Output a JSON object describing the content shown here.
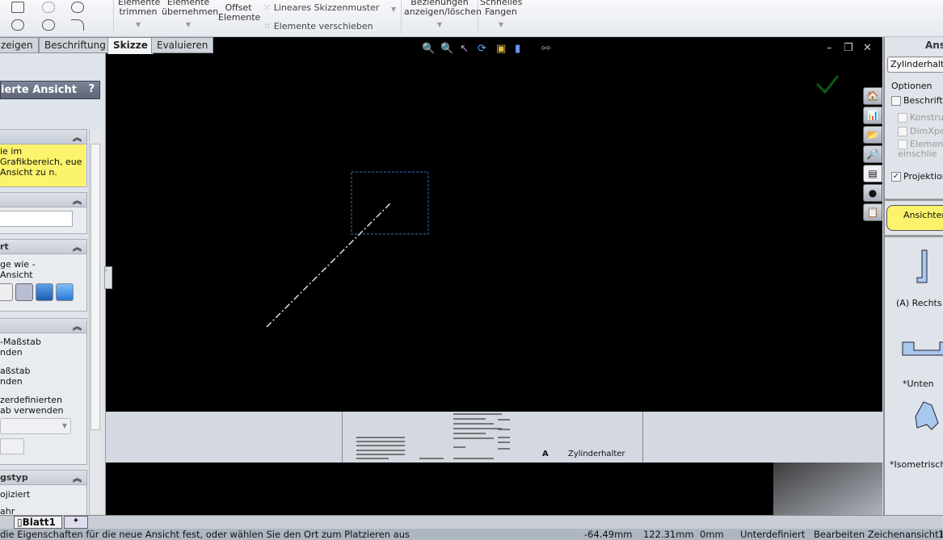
{
  "toolbar": {
    "trim": "Elemente trimmen",
    "convert": "Elemente übernehmen",
    "offset": "Offset Elemente",
    "linear_pattern": "Lineares Skizzenmuster",
    "move": "Elemente verschieben",
    "relations": "Beziehungen anzeigen/löschen",
    "snap": "Schnelles Fangen"
  },
  "tabs": [
    "zeigen",
    "Beschriftung",
    "Skizze",
    "Evaluieren"
  ],
  "left_panel": {
    "title": "ierte Ansicht",
    "help": "?",
    "message": "ie im Grafikbereich, eue Ansicht zu n.",
    "section_style": "rt",
    "style_text": "ge wie -Ansicht",
    "scale_options": [
      "-Maßstab nden",
      "aßstab nden",
      "zerdefinierten ab verwenden"
    ],
    "section_type": "gstyp",
    "type_options": [
      "ojiziert",
      "ahr"
    ]
  },
  "right_panel": {
    "title": "Ansi",
    "model": "Zylinderhalter",
    "options_label": "Optionen",
    "checkboxes": [
      {
        "label": "Beschriftu",
        "checked": false,
        "enabled": true
      },
      {
        "label": "Konstruk",
        "checked": false,
        "enabled": false
      },
      {
        "label": "DimXper",
        "checked": false,
        "enabled": false
      },
      {
        "label": "Elemente einschlie",
        "checked": false,
        "enabled": false
      },
      {
        "label": "Projektion",
        "checked": true,
        "enabled": true
      }
    ],
    "views_button": "Ansichten",
    "views": [
      "(A) Rechts",
      "*Unten",
      "*Isometrisch"
    ]
  },
  "sheet": {
    "part_name": "Zylinderhalter",
    "size": "A",
    "tab": "Blatt1"
  },
  "status": {
    "message": "die Eigenschaften für die neue Ansicht fest, oder wählen Sie den Ort zum Platzieren aus",
    "x": "-64.49mm",
    "y": "122.31mm",
    "z": "0mm",
    "state": "Unterdefiniert",
    "mode": "Bearbeiten Zeichenansicht1",
    "extra": "1"
  }
}
